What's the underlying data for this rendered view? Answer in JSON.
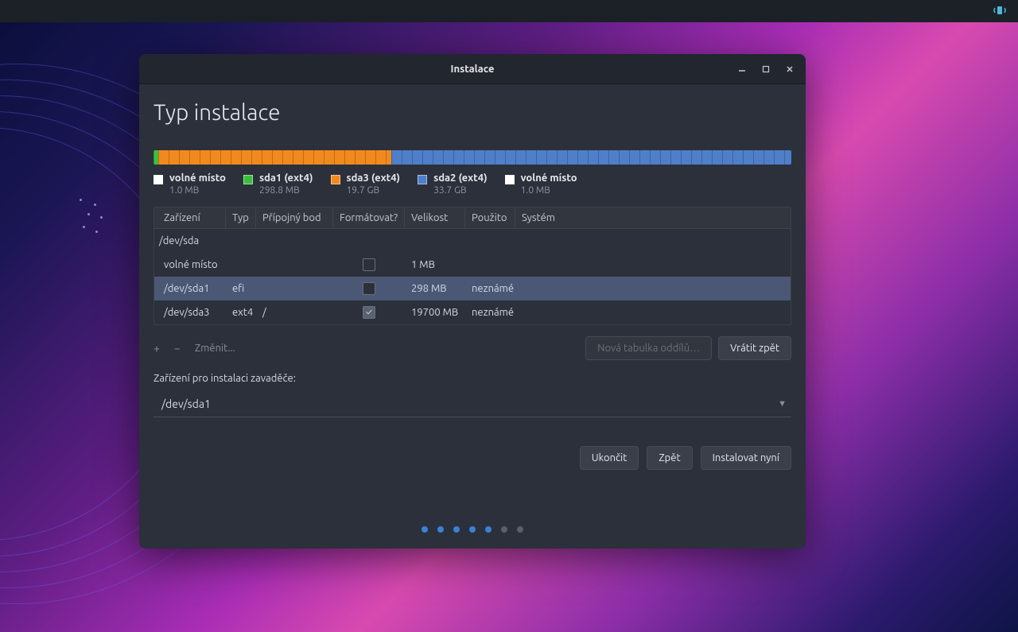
{
  "titlebar": {
    "title": "Instalace"
  },
  "heading": "Typ instalace",
  "diskbar": {
    "segments": [
      {
        "color": "#3bbf3b",
        "pct": 0.8
      },
      {
        "color": "#f08a1f",
        "pct": 36.5
      },
      {
        "color": "#4f7fc9",
        "pct": 62.7
      }
    ]
  },
  "legend": [
    {
      "sq": "#ffffff",
      "name": "volné místo",
      "size": "1.0 MB"
    },
    {
      "sq": "#3bbf3b",
      "name": "sda1 (ext4)",
      "size": "298.8 MB"
    },
    {
      "sq": "#f08a1f",
      "name": "sda3 (ext4)",
      "size": "19.7 GB"
    },
    {
      "sq": "#4f7fc9",
      "name": "sda2 (ext4)",
      "size": "33.7 GB"
    },
    {
      "sq": "#ffffff",
      "name": "volné místo",
      "size": "1.0 MB"
    }
  ],
  "table": {
    "headers": {
      "device": "Zařízení",
      "type": "Typ",
      "mount": "Přípojný bod",
      "format": "Formátovat?",
      "size": "Velikost",
      "used": "Použito",
      "system": "Systém"
    },
    "group": "/dev/sda",
    "rows": [
      {
        "device": "volné místo",
        "type": "",
        "mount": "",
        "format": false,
        "size": "1 MB",
        "used": "",
        "selected": false
      },
      {
        "device": "/dev/sda1",
        "type": "efi",
        "mount": "",
        "format": false,
        "size": "298 MB",
        "used": "neznámé",
        "selected": true
      },
      {
        "device": "/dev/sda3",
        "type": "ext4",
        "mount": "/",
        "format": true,
        "size": "19700 MB",
        "used": "neznámé",
        "selected": false
      }
    ]
  },
  "actions": {
    "change": "Změnit...",
    "new_table": "Nová tabulka oddílů…",
    "revert": "Vrátit zpět"
  },
  "bootloader": {
    "label": "Zařízení pro instalaci zavaděče:",
    "value": "/dev/sda1"
  },
  "nav": {
    "quit": "Ukončit",
    "back": "Zpět",
    "install": "Instalovat nyní"
  },
  "pager": {
    "total": 7,
    "active": 5
  }
}
